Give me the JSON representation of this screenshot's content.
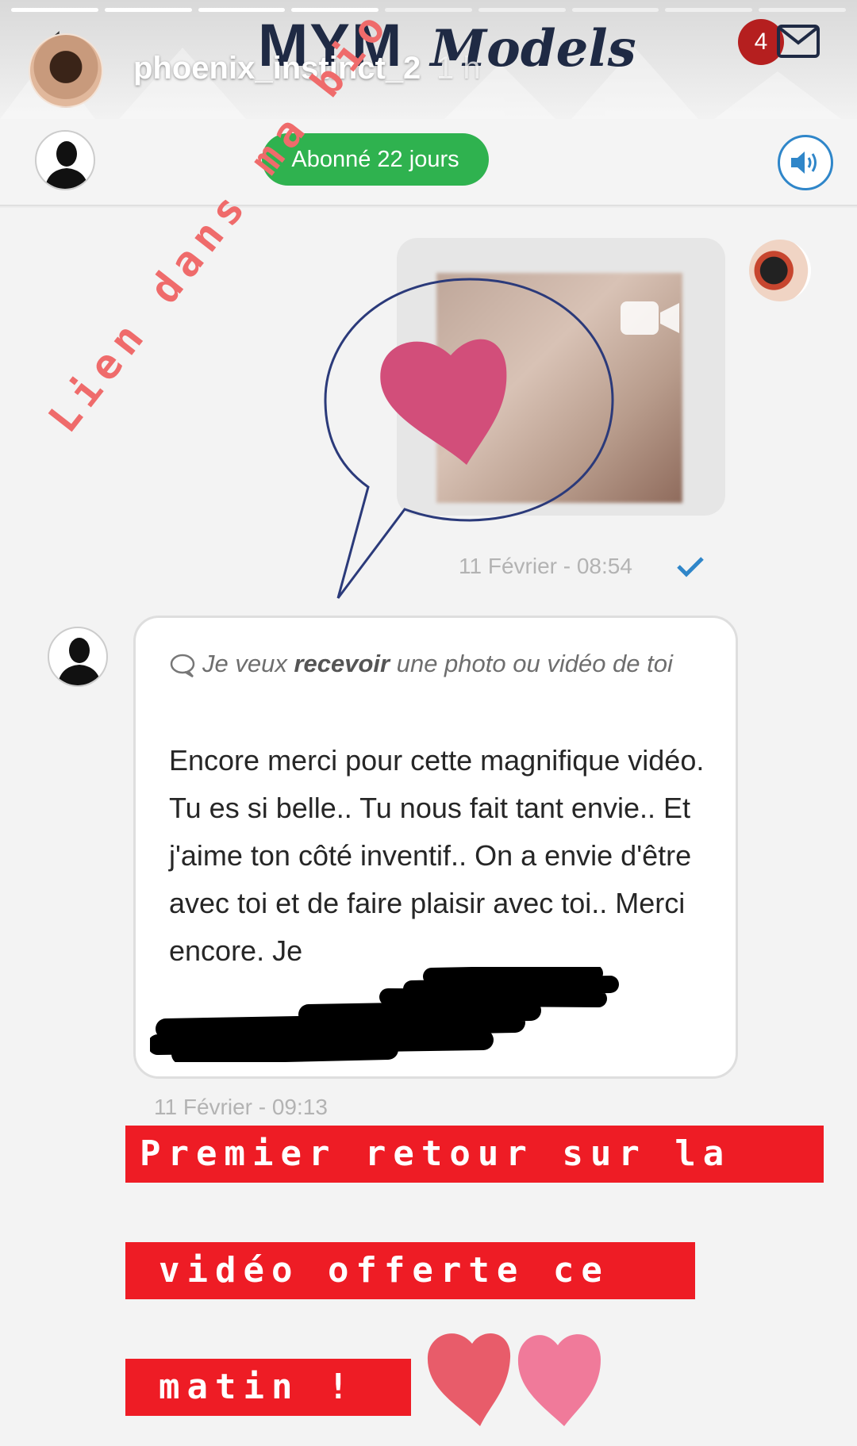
{
  "story": {
    "username": "phoenix_instinct_2",
    "time_ago": "1 h",
    "progress_segments": 9,
    "progress_done": 4
  },
  "app": {
    "brand_left": "MYM",
    "brand_right": "Models",
    "notification_count": "4",
    "brand_color": "#1f2a44",
    "accent_red": "#b51f1f"
  },
  "subscriber": {
    "badge_label": "Abonné 22 jours",
    "badge_color": "#2fb24f"
  },
  "chat": {
    "media_message": {
      "timestamp": "11 Février - 08:54",
      "status_icon": "check-icon"
    },
    "reply_message": {
      "request_prefix": "Je veux ",
      "request_emphasis": "recevoir",
      "request_suffix": " une photo ou vidéo de toi",
      "body": "Encore merci pour cette magnifique vidéo. Tu es si belle.. Tu nous fait tant envie.. Et j'aime ton côté inventif.. On a envie d'être avec toi et de faire plaisir avec toi.. Merci encore. Je",
      "timestamp": "11 Février - 09:13"
    }
  },
  "overlays": {
    "diagonal_text": "Lien dans ma bio",
    "caption_line_1": "Premier retour sur la",
    "caption_line_2": "vidéo offerte ce",
    "caption_line_3": "matin !",
    "caption_color": "#ee1c25"
  }
}
